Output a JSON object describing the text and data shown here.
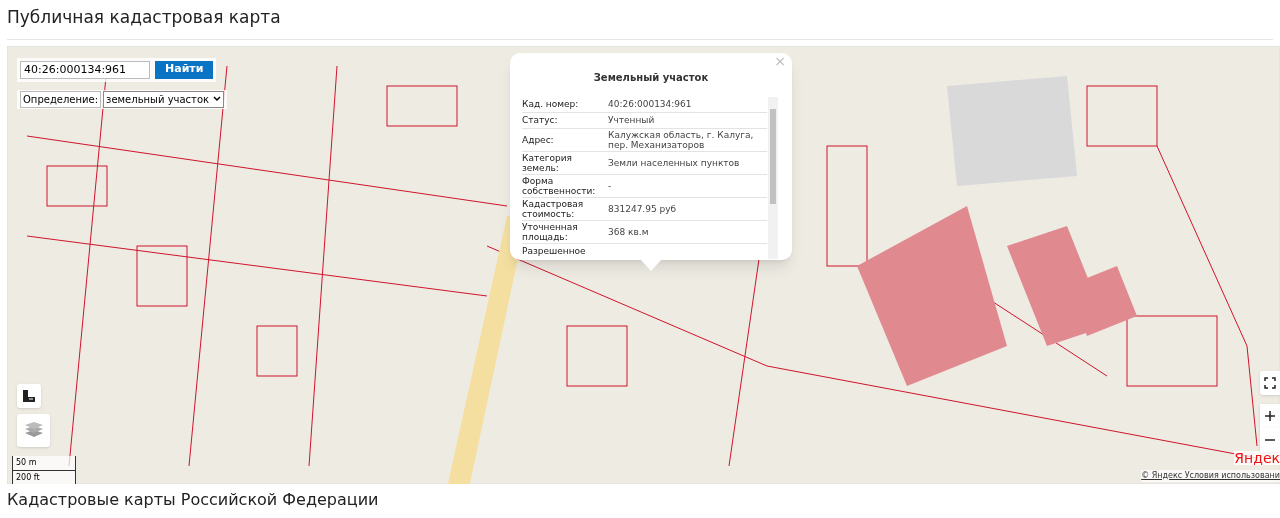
{
  "page_title": "Публичная кадастровая карта",
  "search": {
    "value": "40:26:000134:961",
    "button": "Найти"
  },
  "definition": {
    "label": "Определение:",
    "selected": "земельный участок"
  },
  "popup": {
    "title": "Земельный участок",
    "close": "×",
    "rows": [
      {
        "label": "Кад. номер:",
        "value": "40:26:000134:961"
      },
      {
        "label": "Статус:",
        "value": "Учтенный"
      },
      {
        "label": "Адрес:",
        "value": "Калужская область, г. Калуга, пер. Механизаторов"
      },
      {
        "label": "Категория земель:",
        "value": "Земли населенных пунктов"
      },
      {
        "label": "Форма собственности:",
        "value": "-"
      },
      {
        "label": "Кадастровая стоимость:",
        "value": "831247.95 руб"
      },
      {
        "label": "Уточненная площадь:",
        "value": "368 кв.м"
      },
      {
        "label": "Разрешенное"
      }
    ]
  },
  "scale": [
    "50 m",
    "200 ft"
  ],
  "attribution": {
    "logo": "Яндек",
    "text": "© Яндекс  Условия использовани"
  },
  "section_title": "Кадастровые карты Российской Федерации"
}
